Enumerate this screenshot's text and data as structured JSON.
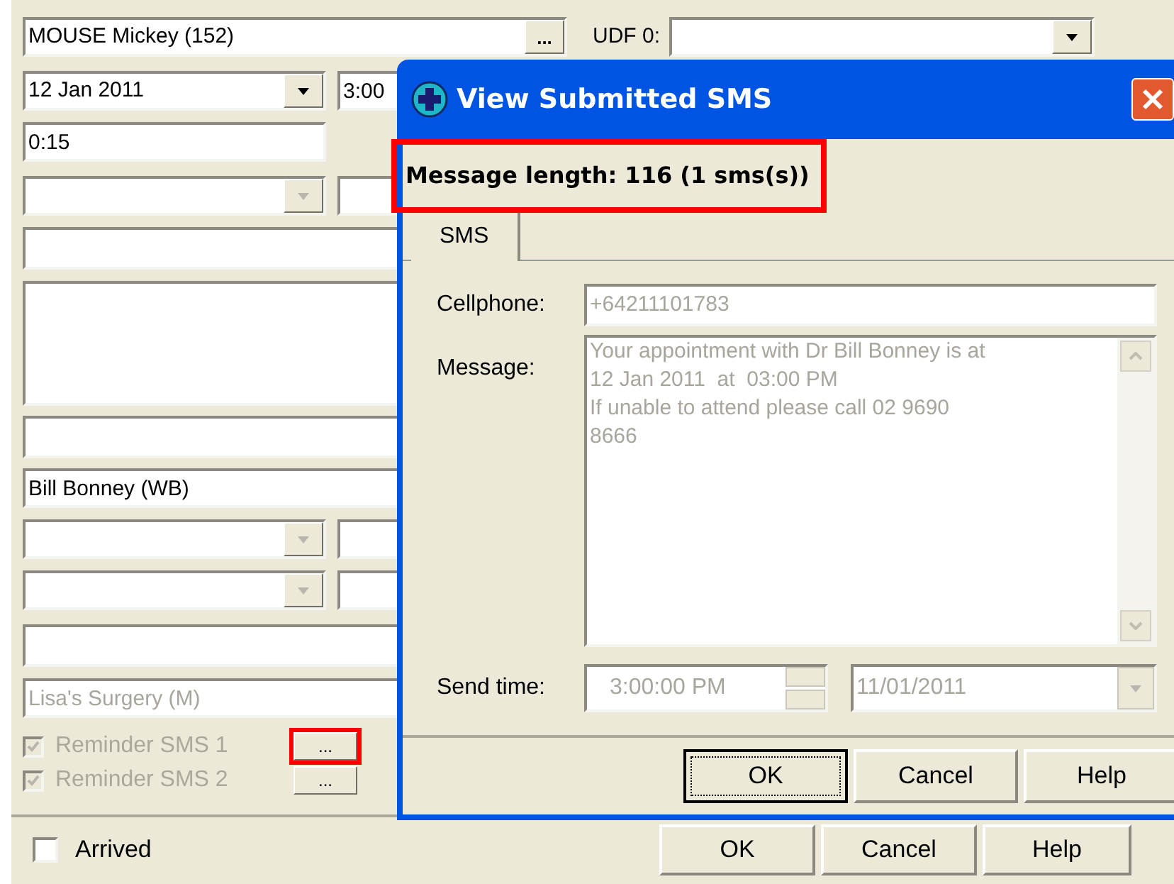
{
  "form": {
    "patient": "MOUSE Mickey (152)",
    "browse_button": "...",
    "udf_label": "UDF 0:",
    "date": "12 Jan 2011",
    "time": "3:00",
    "duration": "0:15",
    "practitioner": "Bill Bonney (WB)",
    "location": {
      "value": "Lisa's Surgery (M)",
      "disabled": true
    },
    "reminders": [
      {
        "label": "Reminder SMS 1",
        "checked": true,
        "disabled": true,
        "button": "...",
        "highlighted": true
      },
      {
        "label": "Reminder SMS 2",
        "checked": true,
        "disabled": true,
        "button": "...",
        "highlighted": false
      }
    ],
    "arrived": {
      "label": "Arrived",
      "checked": false
    },
    "buttons": [
      {
        "label": "OK"
      },
      {
        "label": "Cancel"
      },
      {
        "label": "Help"
      }
    ]
  },
  "dialog": {
    "title": "View Submitted SMS",
    "message_length": {
      "text": "Message length: 116 (1 sms(s))",
      "highlighted": true
    },
    "tabs": [
      {
        "label": "SMS",
        "selected": true
      }
    ],
    "cellphone": {
      "label": "Cellphone:",
      "value": "+64211101783",
      "disabled": true
    },
    "message": {
      "label": "Message:",
      "lines": [
        "Your appointment with Dr Bill Bonney is at",
        "12 Jan 2011  at  03:00 PM",
        "If unable to attend please call 02 9690",
        "8666"
      ],
      "disabled": true
    },
    "send_time": {
      "label": "Send time:",
      "time": "3:00:00 PM",
      "date": "11/01/2011",
      "disabled": true
    },
    "buttons": [
      {
        "label": "OK",
        "default": true
      },
      {
        "label": "Cancel",
        "default": false
      },
      {
        "label": "Help",
        "default": false
      }
    ]
  }
}
